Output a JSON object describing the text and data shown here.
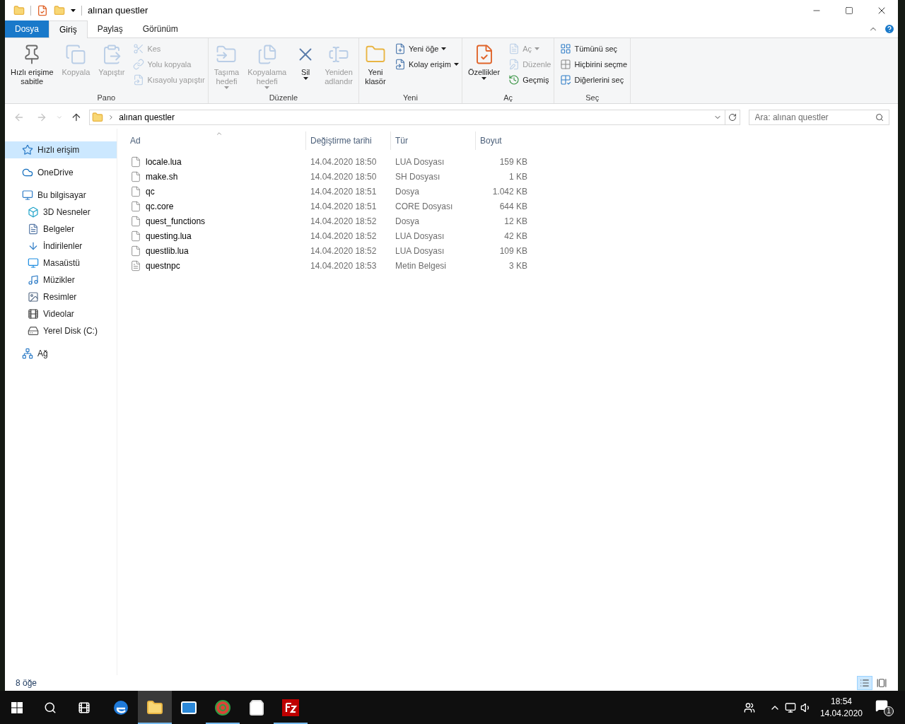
{
  "window": {
    "title": "alınan questler"
  },
  "tabs": [
    {
      "label": "Dosya",
      "kind": "file",
      "selected": false
    },
    {
      "label": "Giriş",
      "kind": "tab",
      "selected": true
    },
    {
      "label": "Paylaş",
      "kind": "tab",
      "selected": false
    },
    {
      "label": "Görünüm",
      "kind": "tab",
      "selected": false
    }
  ],
  "ribbon": {
    "groups": [
      {
        "label": "Pano",
        "items": [
          {
            "kind": "large",
            "label": "Hızlı erişime\nsabitle",
            "disabled": false,
            "dropdown": false
          },
          {
            "kind": "large",
            "label": "Kopyala",
            "disabled": true,
            "dropdown": false
          },
          {
            "kind": "large",
            "label": "Yapıştır",
            "disabled": true,
            "dropdown": false
          },
          {
            "kind": "small",
            "label": "Kes",
            "disabled": true,
            "dropdown": false
          },
          {
            "kind": "small",
            "label": "Yolu kopyala",
            "disabled": true,
            "dropdown": false
          },
          {
            "kind": "small",
            "label": "Kısayolu yapıştır",
            "disabled": true,
            "dropdown": false
          }
        ]
      },
      {
        "label": "Düzenle",
        "items": [
          {
            "kind": "large",
            "label": "Taşıma\nhedefi",
            "disabled": true,
            "dropdown": true
          },
          {
            "kind": "large",
            "label": "Kopyalama\nhedefi",
            "disabled": true,
            "dropdown": true
          },
          {
            "kind": "large",
            "label": "Sil",
            "disabled": false,
            "dropdown": true
          },
          {
            "kind": "large",
            "label": "Yeniden\nadlandır",
            "disabled": true,
            "dropdown": false
          }
        ]
      },
      {
        "label": "Yeni",
        "items": [
          {
            "kind": "large",
            "label": "Yeni\nklasör",
            "disabled": false,
            "dropdown": false
          },
          {
            "kind": "small",
            "label": "Yeni öğe",
            "disabled": false,
            "dropdown": true
          },
          {
            "kind": "small",
            "label": "Kolay erişim",
            "disabled": false,
            "dropdown": true
          }
        ]
      },
      {
        "label": "Aç",
        "items": [
          {
            "kind": "large",
            "label": "Özellikler",
            "disabled": false,
            "dropdown": true
          },
          {
            "kind": "small",
            "label": "Aç",
            "disabled": true,
            "dropdown": true
          },
          {
            "kind": "small",
            "label": "Düzenle",
            "disabled": true,
            "dropdown": false
          },
          {
            "kind": "small",
            "label": "Geçmiş",
            "disabled": false,
            "dropdown": false
          }
        ]
      },
      {
        "label": "Seç",
        "items": [
          {
            "kind": "small",
            "label": "Tümünü seç",
            "disabled": false,
            "dropdown": false
          },
          {
            "kind": "small",
            "label": "Hiçbirini seçme",
            "disabled": false,
            "dropdown": false
          },
          {
            "kind": "small",
            "label": "Diğerlerini seç",
            "disabled": false,
            "dropdown": false
          }
        ]
      }
    ]
  },
  "address": {
    "path": "alınan questler",
    "search_placeholder": "Ara: alınan questler"
  },
  "sidebar": {
    "items": [
      {
        "label": "Hızlı erişim",
        "selected": true
      },
      {
        "label": "OneDrive",
        "selected": false
      },
      {
        "label": "Bu bilgisayar",
        "selected": false,
        "children": [
          {
            "label": "3D Nesneler",
            "selected": false
          },
          {
            "label": "Belgeler",
            "selected": false
          },
          {
            "label": "İndirilenler",
            "selected": false
          },
          {
            "label": "Masaüstü",
            "selected": false
          },
          {
            "label": "Müzikler",
            "selected": false
          },
          {
            "label": "Resimler",
            "selected": false
          },
          {
            "label": "Videolar",
            "selected": false
          },
          {
            "label": "Yerel Disk (C:)",
            "selected": false
          }
        ]
      },
      {
        "label": "Ağ",
        "selected": false
      }
    ]
  },
  "table": {
    "columns": [
      {
        "label": "Ad",
        "sorted": true
      },
      {
        "label": "Değiştirme tarihi",
        "sorted": false
      },
      {
        "label": "Tür",
        "sorted": false
      },
      {
        "label": "Boyut",
        "sorted": false
      }
    ],
    "rows": [
      {
        "kind": "file",
        "name": "locale.lua",
        "date": "14.04.2020 18:50",
        "type": "LUA Dosyası",
        "size": "159 KB"
      },
      {
        "kind": "file",
        "name": "make.sh",
        "date": "14.04.2020 18:50",
        "type": "SH Dosyası",
        "size": "1 KB"
      },
      {
        "kind": "file",
        "name": "qc",
        "date": "14.04.2020 18:51",
        "type": "Dosya",
        "size": "1.042 KB"
      },
      {
        "kind": "file",
        "name": "qc.core",
        "date": "14.04.2020 18:51",
        "type": "CORE Dosyası",
        "size": "644 KB"
      },
      {
        "kind": "file",
        "name": "quest_functions",
        "date": "14.04.2020 18:52",
        "type": "Dosya",
        "size": "12 KB"
      },
      {
        "kind": "file",
        "name": "questing.lua",
        "date": "14.04.2020 18:52",
        "type": "LUA Dosyası",
        "size": "42 KB"
      },
      {
        "kind": "file",
        "name": "questlib.lua",
        "date": "14.04.2020 18:52",
        "type": "LUA Dosyası",
        "size": "109 KB"
      },
      {
        "kind": "text",
        "name": "questnpc",
        "date": "14.04.2020 18:53",
        "type": "Metin Belgesi",
        "size": "3 KB"
      }
    ]
  },
  "status_bar": {
    "count": "8 öğe",
    "views": [
      {
        "selected": true
      },
      {
        "selected": false
      }
    ]
  },
  "taskbar": {
    "apps": [
      {
        "running": false,
        "selected": false
      },
      {
        "running": true,
        "selected": true
      },
      {
        "running": false,
        "selected": false
      },
      {
        "running": true,
        "selected": false
      },
      {
        "running": false,
        "selected": false
      },
      {
        "running": true,
        "selected": false
      }
    ],
    "time": "18:54",
    "date": "14.04.2020",
    "notifications": "1"
  }
}
